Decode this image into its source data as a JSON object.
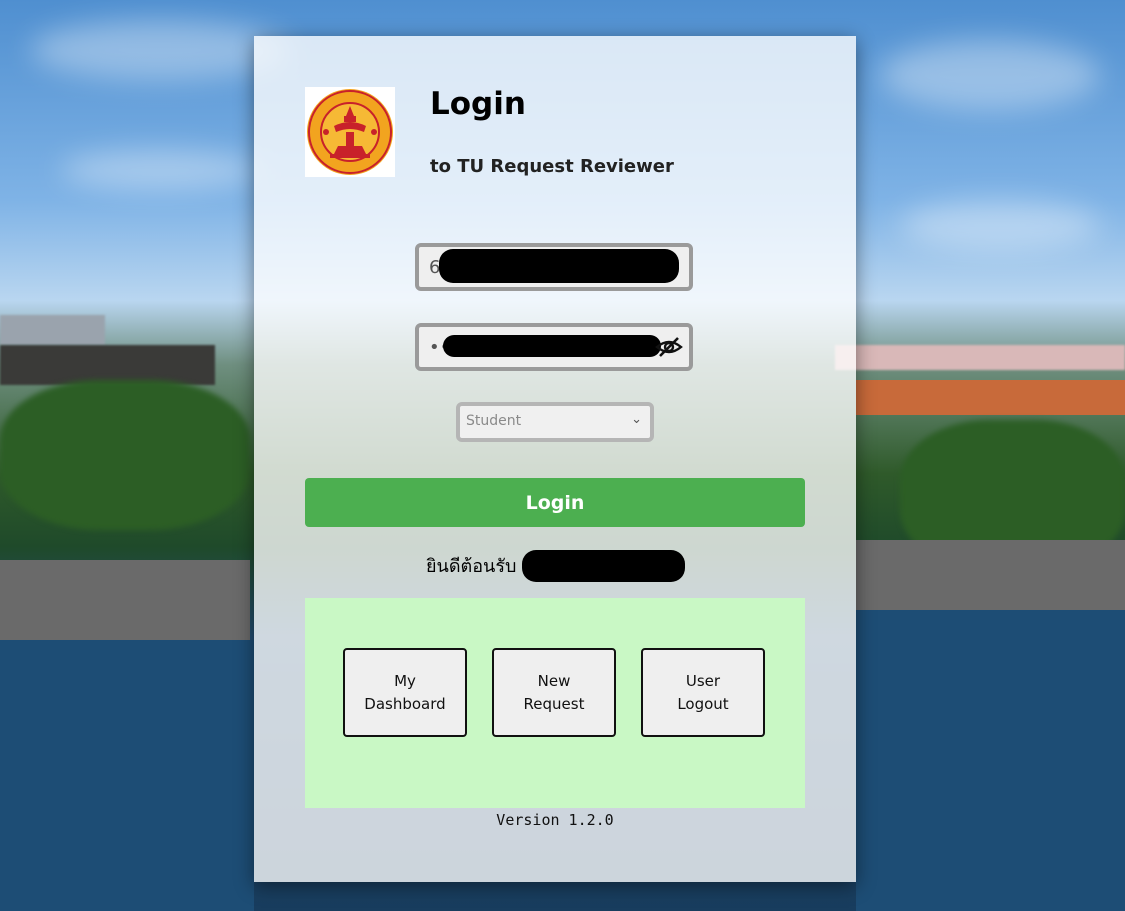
{
  "header": {
    "title": "Login",
    "subtitle": "to TU Request Reviewer",
    "logo_icon": "thammasat-university-seal"
  },
  "form": {
    "username_value": "6",
    "password_value": "••",
    "password_toggle_icon": "eye-off-icon",
    "role_selected": "Student",
    "login_label": "Login"
  },
  "welcome": {
    "text": "ยินดีต้อนรับ"
  },
  "nav": {
    "dashboard_line1": "My",
    "dashboard_line2": "Dashboard",
    "new_request_line1": "New",
    "new_request_line2": "Request",
    "logout_line1": "User",
    "logout_line2": "Logout"
  },
  "footer": {
    "version": "Version 1.2.0"
  },
  "colors": {
    "login_button": "#4caf50",
    "nav_panel": "#c9f8c5",
    "field_border": "#9a9a9a"
  }
}
